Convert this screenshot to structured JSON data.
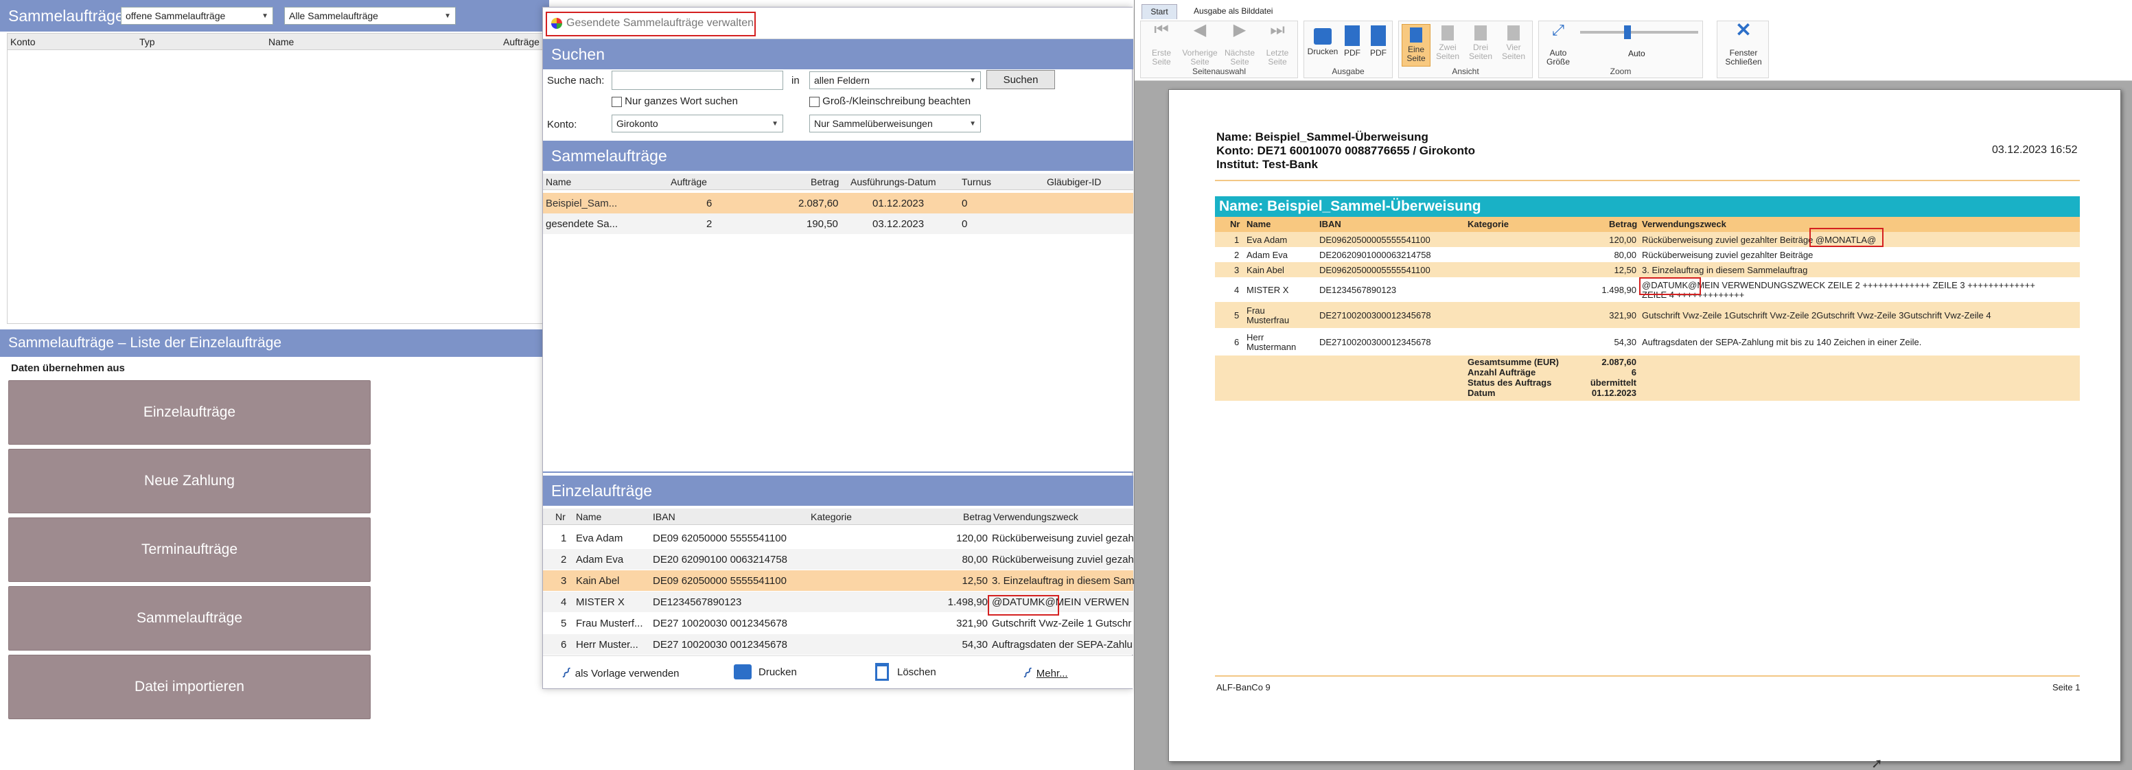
{
  "left": {
    "header_title": "Sammelaufträge",
    "filter1": "offene Sammelaufträge",
    "filter2": "Alle Sammelaufträge",
    "columns": [
      "Konto",
      "Typ",
      "Name",
      "Aufträge"
    ],
    "subtitle": "Sammelaufträge – Liste der Einzelaufträge",
    "data_label": "Daten übernehmen aus",
    "buttons": [
      "Einzelaufträge",
      "Neue Zahlung",
      "Terminaufträge",
      "Sammelaufträge",
      "Datei importieren"
    ]
  },
  "dialog": {
    "title": "Gesendete Sammelaufträge verwalten",
    "search_header": "Suchen",
    "search_label": "Suche nach:",
    "in_label": "in",
    "field_select": "allen Feldern",
    "search_button": "Suchen",
    "whole_word": "Nur ganzes Wort suchen",
    "case_sensitive": "Groß-/Kleinschreibung beachten",
    "konto_label": "Konto:",
    "konto_select": "Girokonto",
    "type_select": "Nur Sammelüberweisungen",
    "sammel_header": "Sammelaufträge",
    "sammel_columns": [
      "Name",
      "Aufträge",
      "Betrag",
      "Ausführungs-Datum",
      "Turnus",
      "Gläubiger-ID"
    ],
    "sammel_rows": [
      {
        "name": "Beispiel_Sam...",
        "auftraege": "6",
        "betrag": "2.087,60",
        "datum": "01.12.2023",
        "turnus": "0"
      },
      {
        "name": "gesendete Sa...",
        "auftraege": "2",
        "betrag": "190,50",
        "datum": "03.12.2023",
        "turnus": "0"
      }
    ],
    "einzel_header": "Einzelaufträge",
    "einzel_columns": [
      "Nr",
      "Name",
      "IBAN",
      "Kategorie",
      "Betrag",
      "Verwendungszweck"
    ],
    "einzel_rows": [
      {
        "nr": "1",
        "name": "Eva Adam",
        "iban": "DE09 62050000 5555541100",
        "betrag": "120,00",
        "zweck": "Rücküberweisung zuviel gezahl"
      },
      {
        "nr": "2",
        "name": "Adam Eva",
        "iban": "DE20 62090100 0063214758",
        "betrag": "80,00",
        "zweck": "Rücküberweisung zuviel gezahl"
      },
      {
        "nr": "3",
        "name": "Kain Abel",
        "iban": "DE09 62050000 5555541100",
        "betrag": "12,50",
        "zweck": "3. Einzelauftrag in diesem Sam"
      },
      {
        "nr": "4",
        "name": "MISTER X",
        "iban": "DE1234567890123",
        "betrag": "1.498,90",
        "zweck": "@DATUMK@MEIN VERWEN"
      },
      {
        "nr": "5",
        "name": "Frau Musterf...",
        "iban": "DE27 10020030 0012345678",
        "betrag": "321,90",
        "zweck": "Gutschrift Vwz-Zeile 1 Gutschr"
      },
      {
        "nr": "6",
        "name": "Herr Muster...",
        "iban": "DE27 10020030 0012345678",
        "betrag": "54,30",
        "zweck": "Auftragsdaten der SEPA-Zahlu"
      }
    ],
    "footer": {
      "vorlage": "als Vorlage verwenden",
      "drucken": "Drucken",
      "loeschen": "Löschen",
      "mehr": "Mehr..."
    }
  },
  "preview": {
    "tabs": [
      "Start",
      "Ausgabe als Bilddatei"
    ],
    "nav_buttons": [
      "Erste Seite",
      "Vorherige Seite",
      "Nächste Seite",
      "Letzte Seite"
    ],
    "nav_group": "Seitenauswahl",
    "out_buttons": [
      "Drucken",
      "PDF",
      "PDF"
    ],
    "out_group": "Ausgabe",
    "view_buttons": [
      "Eine Seite",
      "Zwei Seiten",
      "Drei Seiten",
      "Vier Seiten"
    ],
    "view_group": "Ansicht",
    "zoom_auto_size": "Auto Größe",
    "zoom_auto": "Auto",
    "zoom_group": "Zoom",
    "zoom_level": 0.4,
    "close_button": "Fenster Schließen"
  },
  "document": {
    "head_name": "Name: Beispiel_Sammel-Überweisung",
    "head_konto": "Konto: DE71 60010070 0088776655 / Girokonto",
    "head_institut": "Institut: Test-Bank",
    "head_date": "03.12.2023 16:52",
    "section_title": "Name: Beispiel_Sammel-Überweisung",
    "columns": [
      "Nr",
      "Name",
      "IBAN",
      "Kategorie",
      "Betrag",
      "Verwendungszweck"
    ],
    "rows": [
      {
        "nr": "1",
        "name": "Eva Adam",
        "iban": "DE09620500005555541100",
        "betrag": "120,00",
        "zweck": "Rücküberweisung zuviel gezahlter Beiträge @MONATLA@"
      },
      {
        "nr": "2",
        "name": "Adam Eva",
        "iban": "DE20620901000063214758",
        "betrag": "80,00",
        "zweck": "Rücküberweisung zuviel gezahlter Beiträge"
      },
      {
        "nr": "3",
        "name": "Kain Abel",
        "iban": "DE09620500005555541100",
        "betrag": "12,50",
        "zweck": "3. Einzelauftrag in diesem Sammelauftrag"
      },
      {
        "nr": "4",
        "name": "MISTER X",
        "iban": "DE1234567890123",
        "betrag": "1.498,90",
        "zweck": "@DATUMK@MEIN VERWENDUNGSZWECK ZEILE 2 +++++++++++++ ZEILE 3 +++++++++++++",
        "zweck2": "ZEILE 4 +++++++++++++"
      },
      {
        "nr": "5",
        "name": "Frau",
        "name2": "Musterfrau",
        "iban": "DE27100200300012345678",
        "betrag": "321,90",
        "zweck": "Gutschrift Vwz-Zeile 1Gutschrift Vwz-Zeile 2Gutschrift Vwz-Zeile 3Gutschrift Vwz-Zeile 4"
      },
      {
        "nr": "6",
        "name": "Herr",
        "name2": "Mustermann",
        "iban": "DE27100200300012345678",
        "betrag": "54,30",
        "zweck": "Auftragsdaten der SEPA-Zahlung mit bis zu 140 Zeichen in einer Zeile."
      }
    ],
    "summary": [
      {
        "label": "Gesamtsumme (EUR)",
        "value": "2.087,60"
      },
      {
        "label": "Anzahl Aufträge",
        "value": "6"
      },
      {
        "label": "Status des Auftrags",
        "value": "übermittelt"
      },
      {
        "label": "Datum",
        "value": "01.12.2023"
      }
    ],
    "footer_left": "ALF-BanCo 9",
    "footer_right": "Seite 1"
  }
}
